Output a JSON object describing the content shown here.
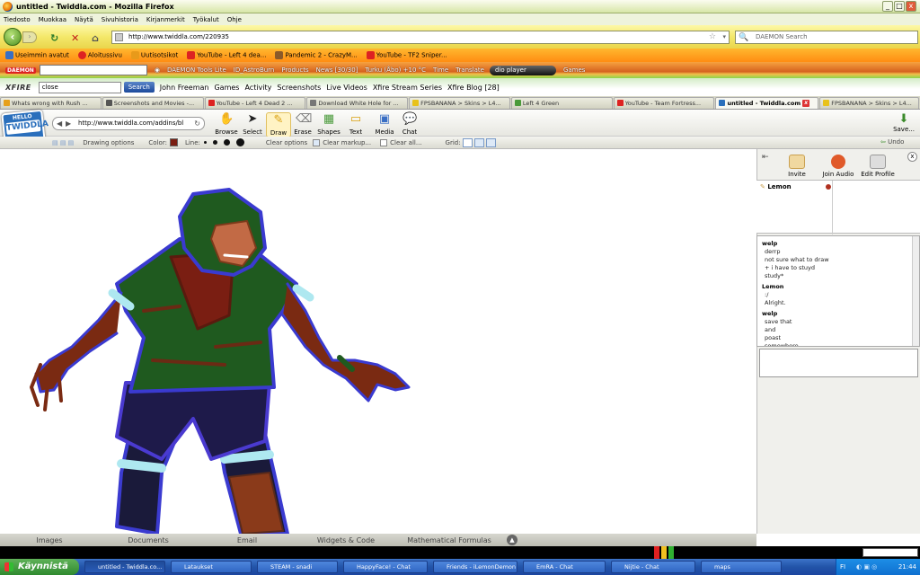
{
  "window": {
    "title": "untitled - Twiddla.com - Mozilla Firefox"
  },
  "menu": [
    "Tiedosto",
    "Muokkaa",
    "Näytä",
    "Sivuhistoria",
    "Kirjanmerkit",
    "Työkalut",
    "Ohje"
  ],
  "nav": {
    "url": "http://www.twiddla.com/220935",
    "search_placeholder": "DAEMON Search"
  },
  "bookmarks": [
    {
      "label": "Useimmin avatut",
      "color": "#3a6fc4"
    },
    {
      "label": "Aloitussivu",
      "color": "#d22"
    },
    {
      "label": "Uutisotsikot",
      "color": "#e89a1a"
    },
    {
      "label": "YouTube - Left 4 dea...",
      "color": "#d22"
    },
    {
      "label": "Pandemic 2 - CrazyM...",
      "color": "#8a5a2a"
    },
    {
      "label": "YouTube - TF2 Sniper...",
      "color": "#d22"
    }
  ],
  "daemon": {
    "logo": "DAEMON",
    "items": [
      "DAEMON Tools Lite",
      "ID_AstroBurn",
      "Products",
      "News [30/30]",
      "Turku (Åbo) +10 °C",
      "Time",
      "Translate"
    ],
    "player": "dio player",
    "games": "Games"
  },
  "xfire": {
    "logo": "XFIRE",
    "search_value": "close",
    "search_button": "Search",
    "items": [
      "John Freeman",
      "Games",
      "Activity",
      "Screenshots",
      "Live Videos",
      "Xfire Stream Series",
      "Xfire Blog [28]"
    ]
  },
  "tabs": [
    {
      "label": "Whats wrong with Rush ...",
      "active": false,
      "color": "#e6a01a"
    },
    {
      "label": "Screenshots and Movies -...",
      "active": false,
      "color": "#555"
    },
    {
      "label": "YouTube - Left 4 Dead 2 ...",
      "active": false,
      "color": "#d22"
    },
    {
      "label": "Download White Hole for ...",
      "active": false,
      "color": "#777"
    },
    {
      "label": "FPSBANANA > Skins > L4...",
      "active": false,
      "color": "#e8c21a"
    },
    {
      "label": "Left 4 Green",
      "active": false,
      "color": "#4a9a3a"
    },
    {
      "label": "YouTube - Team Fortress...",
      "active": false,
      "color": "#d22"
    },
    {
      "label": "untitled - Twiddla.com",
      "active": true,
      "color": "#2a6fbc"
    },
    {
      "label": "FPSBANANA > Skins > L4...",
      "active": false,
      "color": "#e8c21a"
    }
  ],
  "twiddla": {
    "logo_top": "HELLO",
    "logo_name": "TWIDDLA",
    "inner_url": "http://www.twiddla.com/addins/bl",
    "tools": [
      "Browse",
      "Select",
      "Draw",
      "Erase",
      "Shapes",
      "Text",
      "Media",
      "Chat"
    ],
    "save": "Save...",
    "undo": "Undo"
  },
  "drawing_options": {
    "label": "Drawing options",
    "color_label": "Color:",
    "color": "#7a1e12",
    "line_label": "Line:",
    "clear_options": "Clear options",
    "clear_markup": "Clear markup...",
    "clear_all": "Clear all...",
    "grid_label": "Grid:"
  },
  "side": {
    "tools": [
      "Invite",
      "Join Audio",
      "Edit Profile"
    ],
    "user": "Lemon",
    "chat": [
      {
        "who": "welp",
        "lines": [
          "derrp",
          "not sure what to draw",
          "+ i have to stuyd",
          "study*"
        ]
      },
      {
        "who": "Lemon",
        "lines": [
          ":/",
          "Alright."
        ]
      },
      {
        "who": "welp",
        "lines": [
          "save that",
          "and",
          "poast",
          "somewhere"
        ]
      }
    ]
  },
  "bottom_tabs": [
    "Images",
    "Documents",
    "Email",
    "Widgets & Code",
    "Mathematical Formulas"
  ],
  "taskbar": {
    "start": "Käynnistä",
    "tasks": [
      "untitled - Twiddla.co...",
      "Lataukset",
      "STEAM - snadi",
      "HappyFace! - Chat",
      "Friends - iLemonDemon",
      "EmRA - Chat",
      "Nijtie - Chat",
      "maps"
    ],
    "lang": "FI",
    "time": "21:44"
  }
}
